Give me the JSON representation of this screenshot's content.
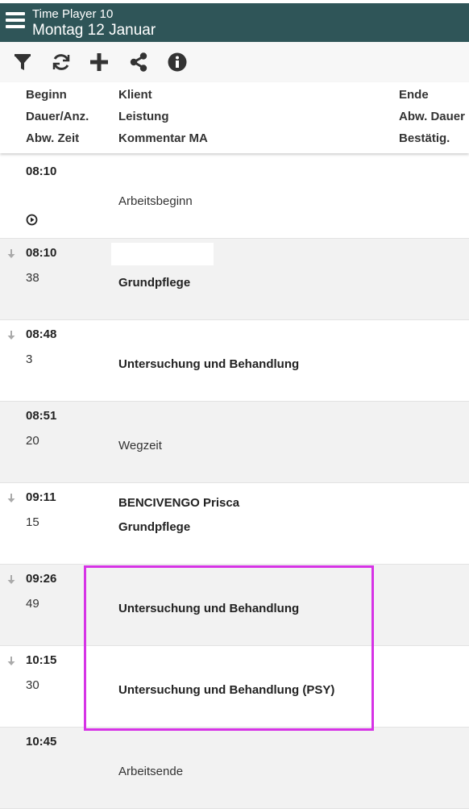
{
  "header": {
    "app_title": "Time Player 10",
    "date_title": "Montag 12 Januar",
    "background_color": "#2f5558"
  },
  "toolbar": {
    "icons": [
      "filter-icon",
      "refresh-icon",
      "add-icon",
      "share-icon",
      "info-icon"
    ]
  },
  "columns": {
    "row1": [
      "Beginn",
      "Klient",
      "Ende"
    ],
    "row2": [
      "Dauer/Anz.",
      "Leistung",
      "Abw. Dauer"
    ],
    "row3": [
      "Abw. Zeit",
      "Kommentar MA",
      "Bestätig."
    ]
  },
  "entries": [
    {
      "time": "08:10",
      "duration": "",
      "client": "",
      "service": "Arbeitsbeginn",
      "service_bold": false,
      "has_arrow": false,
      "has_play_icon": true
    },
    {
      "time": "08:10",
      "duration": "38",
      "client": "",
      "service": "Grundpflege",
      "service_bold": true,
      "has_arrow": true,
      "redacted_client": true
    },
    {
      "time": "08:48",
      "duration": "3",
      "client": "",
      "service": "Untersuchung und Behandlung",
      "service_bold": true,
      "has_arrow": true
    },
    {
      "time": "08:51",
      "duration": "20",
      "client": "",
      "service": "Wegzeit",
      "service_bold": false,
      "has_arrow": false
    },
    {
      "time": "09:11",
      "duration": "15",
      "client": "BENCIVENGO Prisca",
      "service": "Grundpflege",
      "service_bold": true,
      "has_arrow": true
    },
    {
      "time": "09:26",
      "duration": "49",
      "client": "",
      "service": "Untersuchung und Behandlung",
      "service_bold": true,
      "has_arrow": true
    },
    {
      "time": "10:15",
      "duration": "30",
      "client": "",
      "service": "Untersuchung und Behandlung (PSY)",
      "service_bold": true,
      "has_arrow": true
    },
    {
      "time": "10:45",
      "duration": "",
      "client": "",
      "service": "Arbeitsende",
      "service_bold": false,
      "has_arrow": false
    }
  ],
  "highlight_color": "#d633e6"
}
